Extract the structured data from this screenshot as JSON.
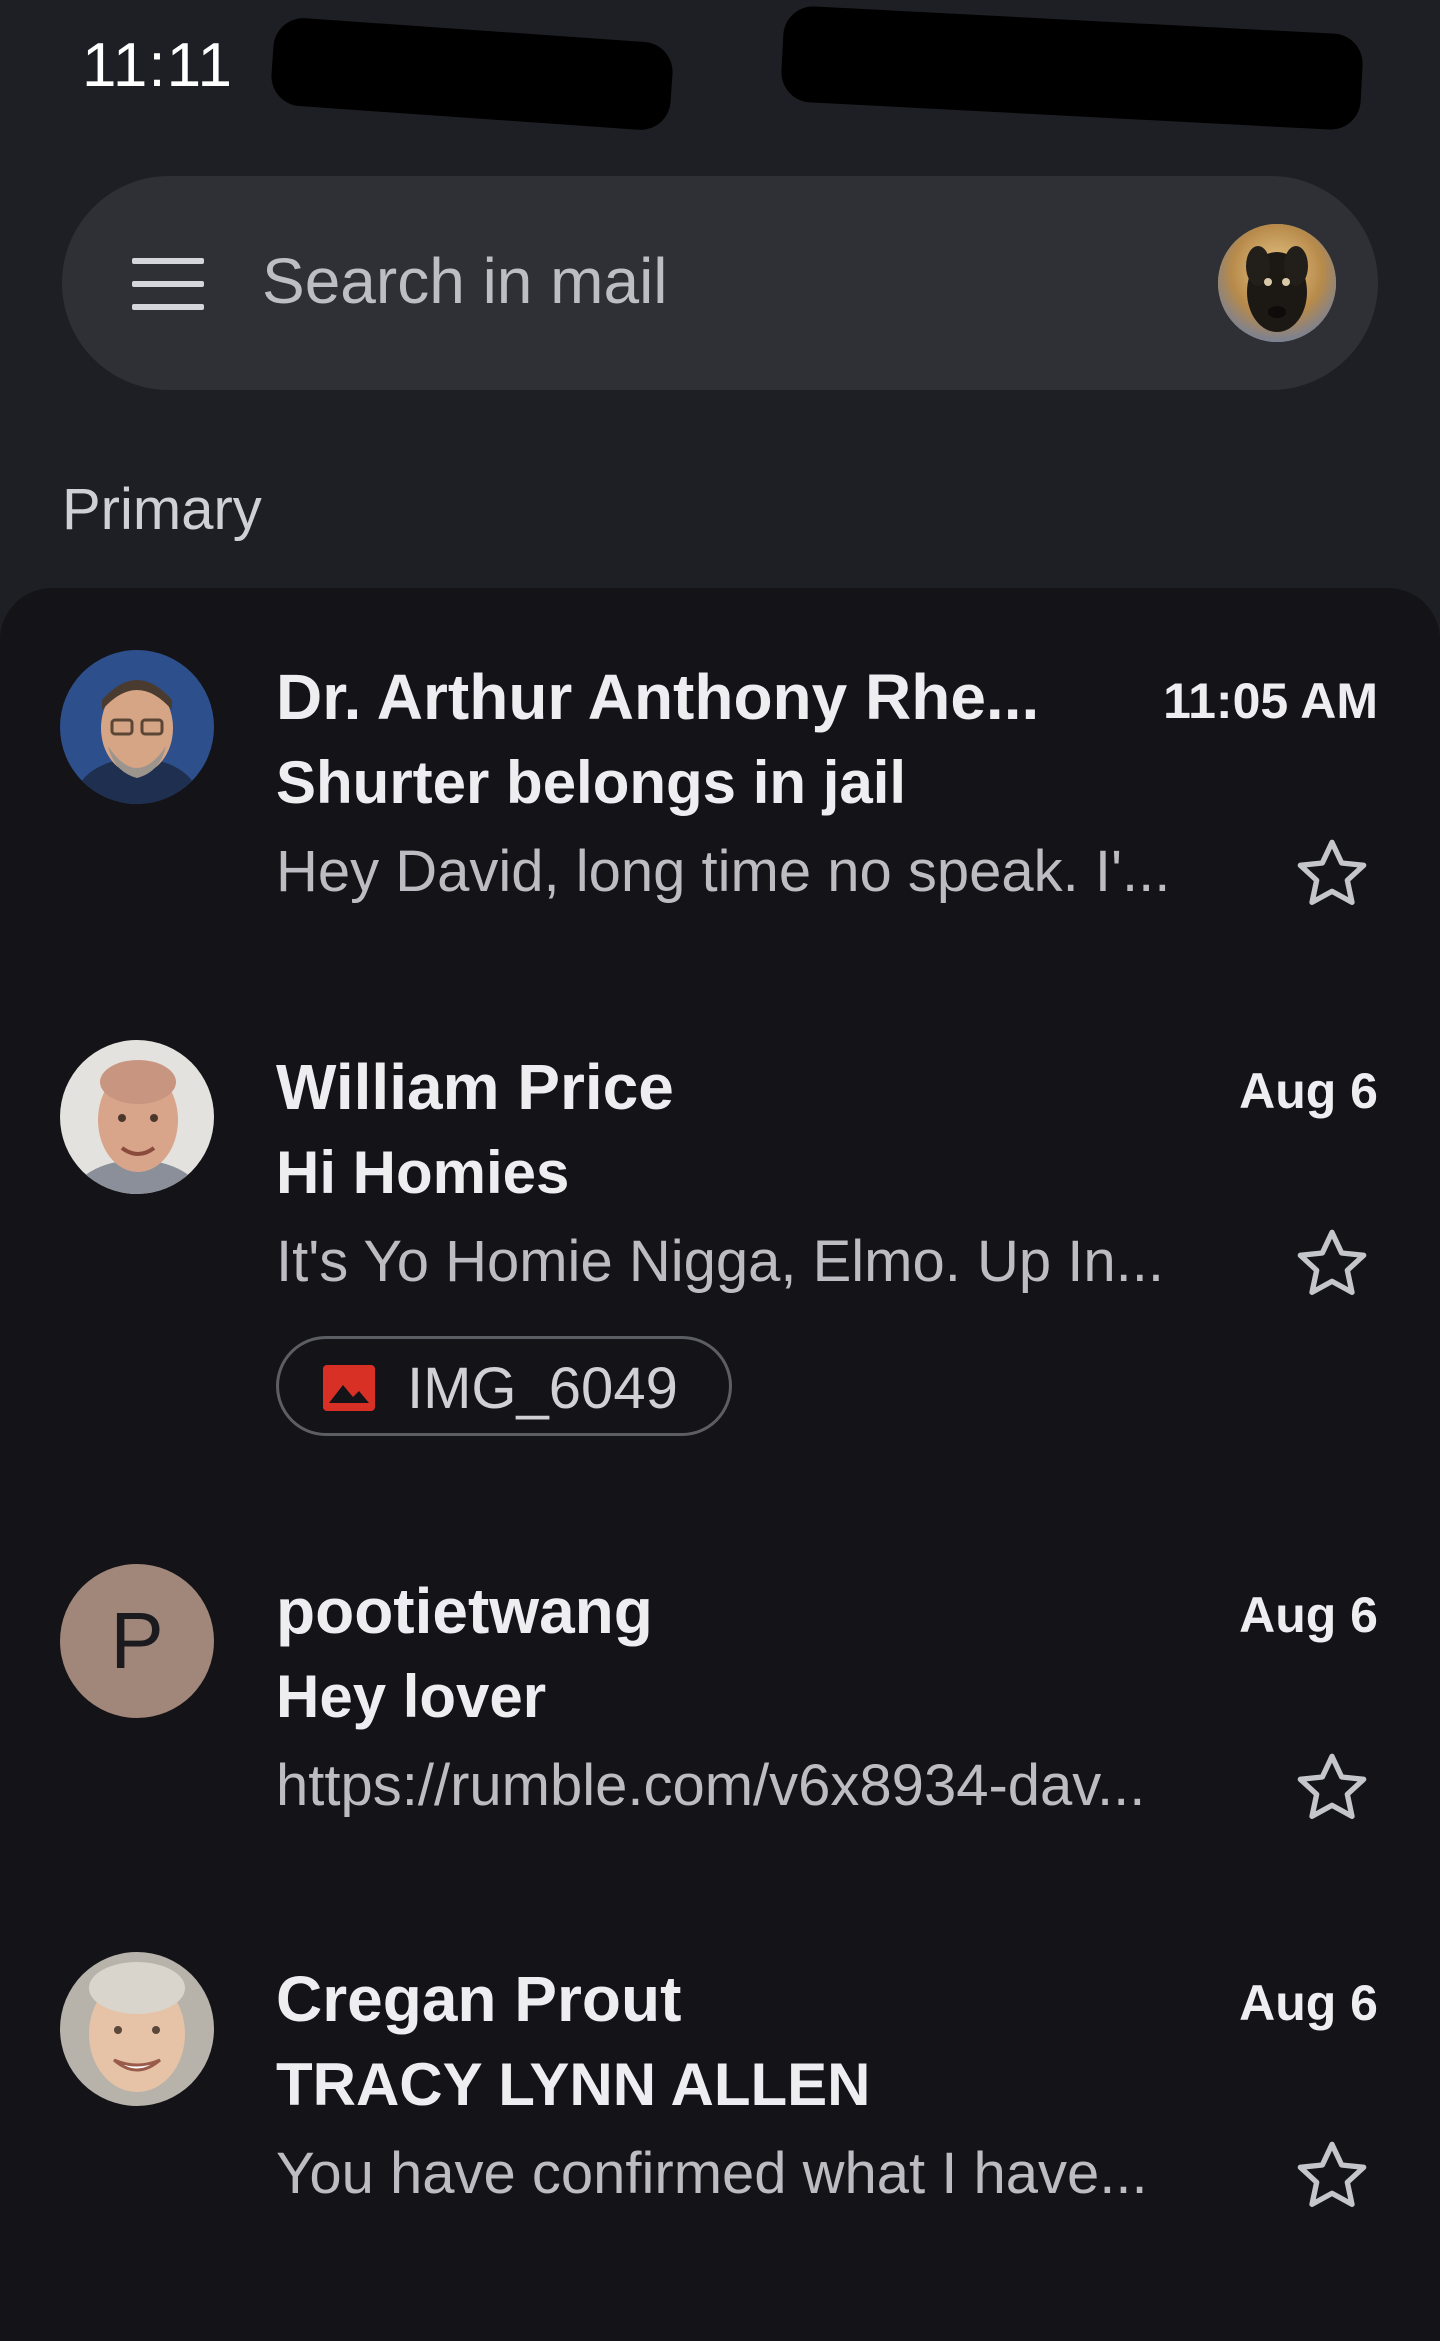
{
  "status_bar": {
    "time": "11:11"
  },
  "search": {
    "placeholder": "Search in mail"
  },
  "section": {
    "label": "Primary"
  },
  "emails": [
    {
      "sender": "Dr. Arthur Anthony Rhe...",
      "date": "11:05 AM",
      "subject": "Shurter belongs in jail",
      "snippet": "Hey David, long time no speak. I'...",
      "avatar": "photo-older-man-glasses-beard",
      "starred": false
    },
    {
      "sender": "William Price",
      "date": "Aug 6",
      "subject": "Hi Homies",
      "snippet": "It's Yo Homie Nigga, Elmo. Up In...",
      "avatar": "photo-bald-man-smiling",
      "starred": false,
      "attachment": {
        "name": "IMG_6049",
        "icon": "image-icon"
      }
    },
    {
      "sender": "pootietwang",
      "date": "Aug 6",
      "subject": "Hey lover",
      "snippet": "https://rumble.com/v6x8934-dav...",
      "avatar_letter": "P",
      "starred": false
    },
    {
      "sender": "Cregan Prout",
      "date": "Aug 6",
      "subject": "TRACY LYNN ALLEN",
      "snippet": "You have confirmed what I have...",
      "avatar": "photo-older-man-smiling",
      "starred": false
    }
  ],
  "colors": {
    "background": "#1e1f24",
    "list_background": "#131318",
    "search_bar": "#2f3035",
    "attachment_icon": "#d93025",
    "letter_avatar": "#a1867a"
  }
}
